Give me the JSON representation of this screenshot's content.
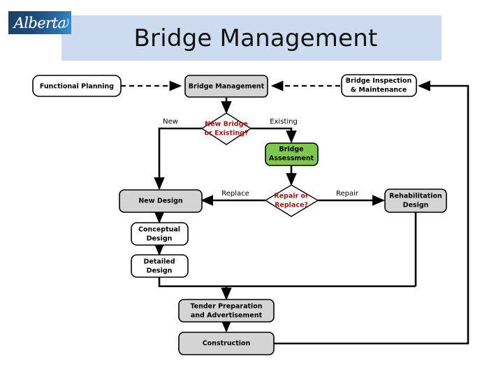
{
  "header": {
    "title": "Bridge Management",
    "logo_text": "Alberta",
    "banner_color": "#ccdcee",
    "logo_color": "#1f4d7c"
  },
  "diagram": {
    "type": "flowchart",
    "nodes": [
      {
        "id": "functional-planning",
        "label_line1": "Functional Planning",
        "label_line2": "",
        "shape": "rounded-rect",
        "fill": "#ffffff",
        "text_color": "#000000"
      },
      {
        "id": "bridge-management",
        "label_line1": "Bridge Management",
        "label_line2": "",
        "shape": "rounded-rect",
        "fill": "#d4d4d4",
        "text_color": "#000000"
      },
      {
        "id": "bridge-inspection",
        "label_line1": "Bridge Inspection",
        "label_line2": "& Maintenance",
        "shape": "rounded-rect",
        "fill": "#ffffff",
        "text_color": "#000000"
      },
      {
        "id": "new-bridge-or-existing",
        "label_line1": "New Bridge",
        "label_line2": "or Existing?",
        "shape": "diamond",
        "fill": "#ffffff",
        "text_color": "#a01818"
      },
      {
        "id": "bridge-assessment",
        "label_line1": "Bridge",
        "label_line2": "Assessment",
        "shape": "rounded-rect",
        "fill": "#7ec850",
        "text_color": "#000000"
      },
      {
        "id": "repair-or-replace",
        "label_line1": "Repair or",
        "label_line2": "Replace?",
        "shape": "diamond",
        "fill": "#ffffff",
        "text_color": "#a01818"
      },
      {
        "id": "new-design",
        "label_line1": "New Design",
        "label_line2": "",
        "shape": "rounded-rect",
        "fill": "#d4d4d4",
        "text_color": "#000000"
      },
      {
        "id": "rehabilitation-design",
        "label_line1": "Rehabilitation",
        "label_line2": "Design",
        "shape": "rounded-rect",
        "fill": "#d4d4d4",
        "text_color": "#000000"
      },
      {
        "id": "conceptual-design",
        "label_line1": "Conceptual",
        "label_line2": "Design",
        "shape": "rounded-rect",
        "fill": "#ffffff",
        "text_color": "#000000"
      },
      {
        "id": "detailed-design",
        "label_line1": "Detailed",
        "label_line2": "Design",
        "shape": "rounded-rect",
        "fill": "#ffffff",
        "text_color": "#000000"
      },
      {
        "id": "tender-preparation",
        "label_line1": "Tender Preparation",
        "label_line2": "and Advertisement",
        "shape": "rounded-rect",
        "fill": "#d4d4d4",
        "text_color": "#000000"
      },
      {
        "id": "construction",
        "label_line1": "Construction",
        "label_line2": "",
        "shape": "rounded-rect",
        "fill": "#d4d4d4",
        "text_color": "#000000"
      }
    ],
    "edge_labels": [
      {
        "id": "edge-label-new",
        "text": "New"
      },
      {
        "id": "edge-label-existing",
        "text": "Existing"
      },
      {
        "id": "edge-label-replace",
        "text": "Replace"
      },
      {
        "id": "edge-label-repair",
        "text": "Repair"
      }
    ]
  }
}
